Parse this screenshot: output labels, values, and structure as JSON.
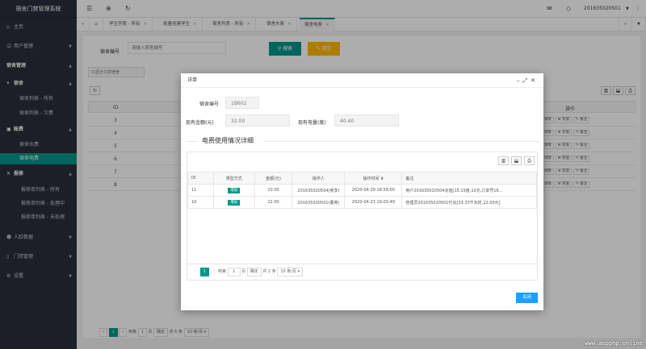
{
  "app_title": "宿舍门禁管理系统",
  "user": "201635020501",
  "sidebar": {
    "home": "主页",
    "user_mgmt": "用户管理",
    "dorm_mgmt": "宿舍管理",
    "dorm": "宿舍",
    "dorm_list_all": "宿舍列表 - 所有",
    "dorm_list_unpaid": "宿舍列表 - 欠费",
    "bills": "账费",
    "water_fee": "宿舍水费",
    "electric_fee": "宿舍电费",
    "repair": "报修",
    "repair_all": "报修单列表 - 所有",
    "repair_processing": "报修单列表 - 处理中",
    "repair_unprocessed": "报修单列表 - 未处理",
    "face_data": "人脸数据",
    "door_mgmt": "门禁管理",
    "settings": "设置"
  },
  "tabs": [
    "学生列表 - 所有",
    "批量创建学生",
    "宿舍列表 - 所有",
    "宿舍水费",
    "宿舍电费"
  ],
  "page": {
    "dorm_no_label": "宿舍编号",
    "dorm_no_placeholder": "请输入宿舍编号",
    "search_btn": "搜索",
    "reset_btn": "清空",
    "list_btn": "只显示欠费宿舍",
    "col_id": "ID",
    "col_op": "操作",
    "ids": [
      "3",
      "4",
      "5",
      "6",
      "7",
      "8"
    ],
    "op_detail": "详情",
    "op_recharge": "充值",
    "op_note": "备注",
    "pager": {
      "current": "1",
      "goto": "到第",
      "page_input": "1",
      "page_unit": "页",
      "confirm": "确定",
      "total": "共 6 条",
      "per_page": "10 条/页"
    }
  },
  "modal": {
    "title": "详单",
    "dorm_no_label": "宿舍编号",
    "dorm_no_value": "1B602",
    "balance_label": "现有金额(元)",
    "balance_value": "32.00",
    "power_label": "现有电量(度)",
    "power_value": "40.40",
    "section_title": "电费使用情况详细",
    "table": {
      "headers": [
        "ID",
        "类型方式",
        "金额(元)",
        "操作人",
        "操作时间",
        "备注"
      ],
      "rows": [
        [
          "11",
          "增加",
          "10.00",
          "201635020504(吴李)",
          "2020-04-29 18:59:00",
          "用户201635020504充值[15.15度,10元,订单号16..."
        ],
        [
          "10",
          "增加",
          "22.00",
          "201635020501(董英)",
          "2020-04-23 19:03:49",
          "管理员201635020501代充[33.33千瓦时,22.00元]"
        ]
      ]
    },
    "pager": {
      "current": "1",
      "goto": "到第",
      "page_input": "1",
      "page_unit": "页",
      "confirm": "确定",
      "total": "共 2 条",
      "per_page": "10 条/页"
    },
    "close_btn": "关闭"
  },
  "watermark": "www.aspphp.online",
  "colors": {
    "sidebar": "#2a2f3a",
    "accent": "#009688",
    "warning": "#FFB800",
    "primary": "#1E9FFF"
  }
}
